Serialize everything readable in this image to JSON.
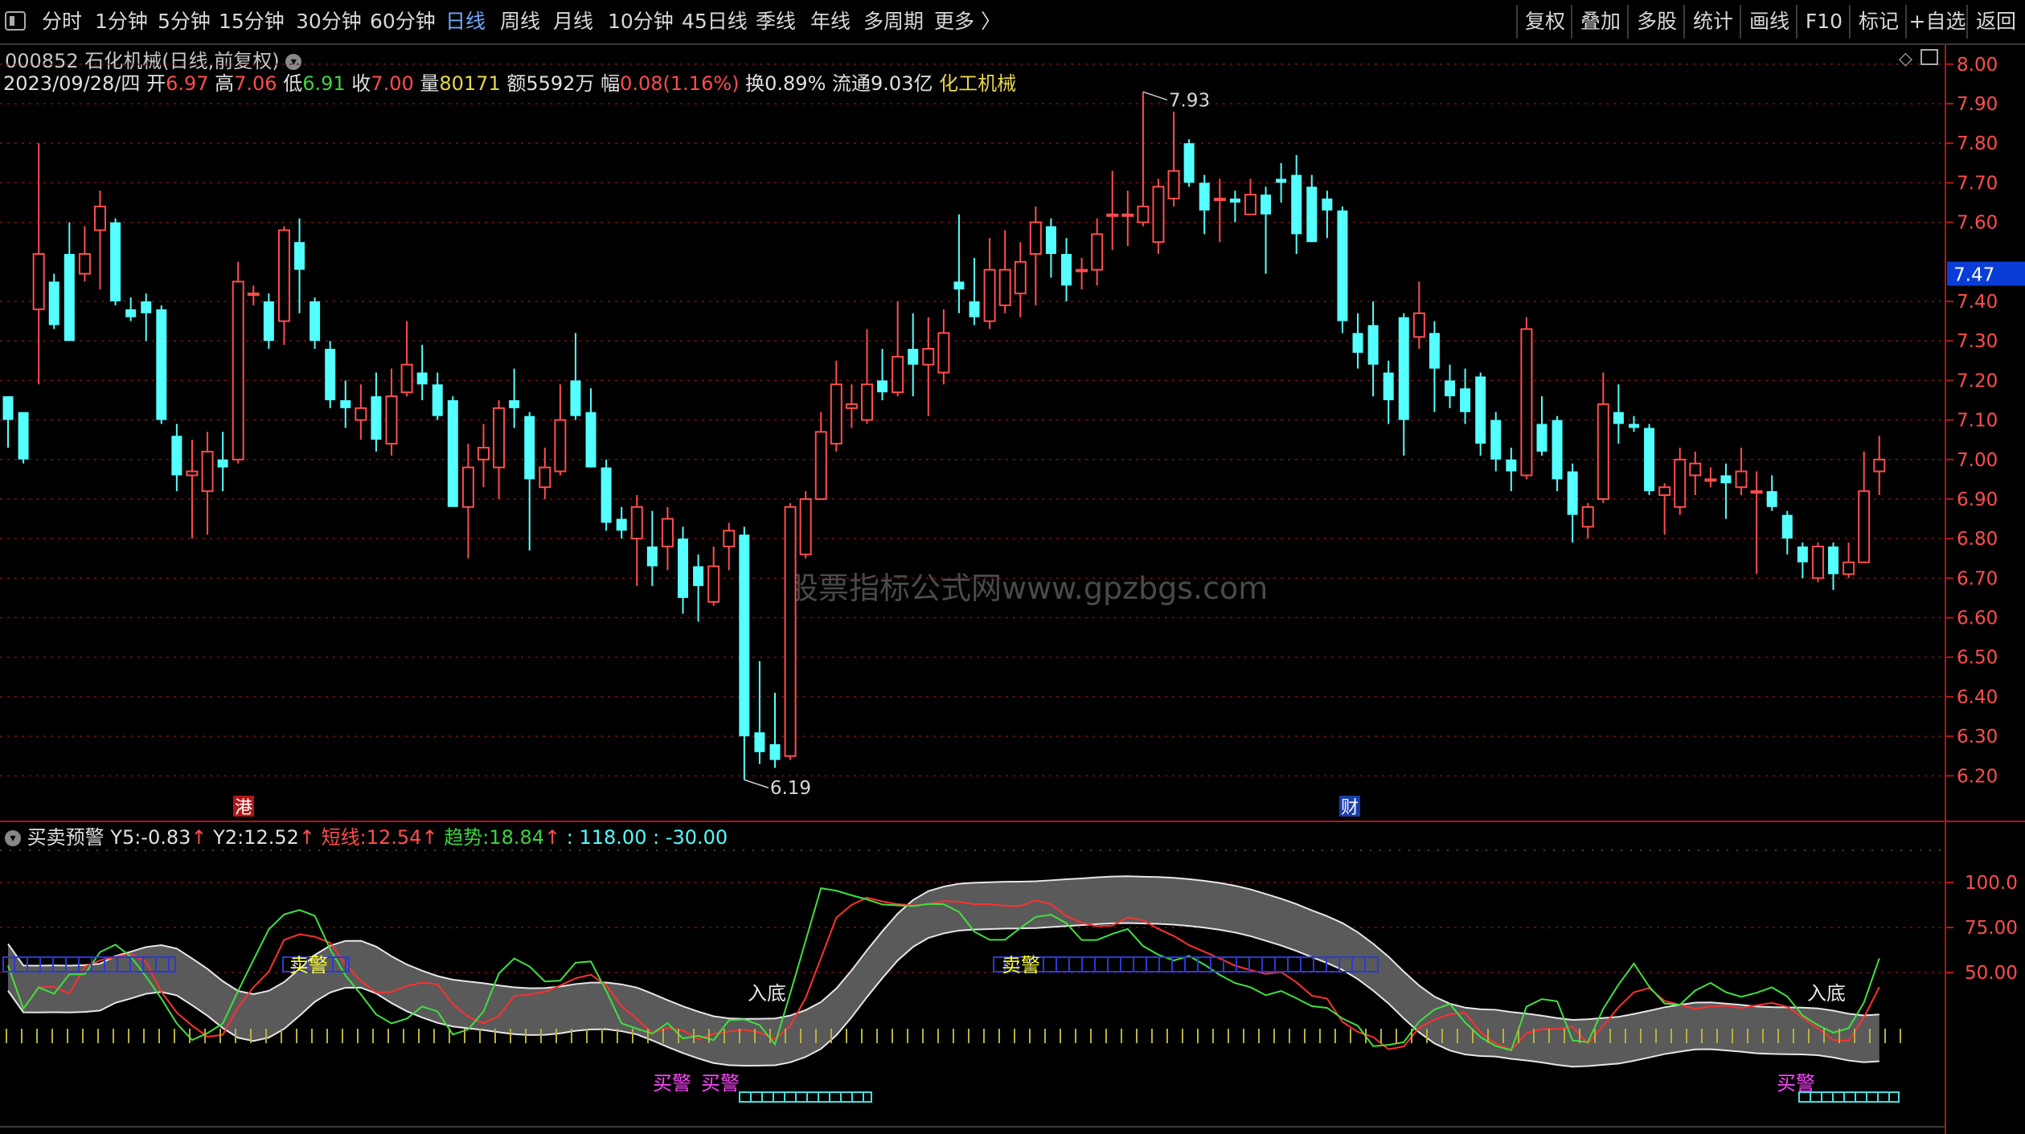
{
  "toolbar": {
    "periods": [
      "分时",
      "1分钟",
      "5分钟",
      "15分钟",
      "30分钟",
      "60分钟",
      "日线",
      "周线",
      "月线",
      "10分钟",
      "45日线",
      "季线",
      "年线",
      "多周期",
      "更多"
    ],
    "active_index": 6,
    "right_buttons": [
      "复权",
      "叠加",
      "多股",
      "统计",
      "画线",
      "F10",
      "标记",
      "+自选",
      "返回"
    ]
  },
  "stock": {
    "title": "000852 石化机械(日线,前复权)",
    "date": "2023/09/28/四",
    "open_label": "开",
    "open": "6.97",
    "high_label": "高",
    "high": "7.06",
    "low_label": "低",
    "low": "6.91",
    "close_label": "收",
    "close": "7.00",
    "volume_label": "量",
    "volume": "80171",
    "amount_label": "额",
    "amount": "5592万",
    "change_label": "幅",
    "change": "0.08(1.16%)",
    "turnover_label": "换",
    "turnover": "0.89%",
    "float_label": "流通",
    "float_cap": "9.03亿",
    "sector": "化工机械"
  },
  "watermark": "股票指标公式网www.gpzbgs.com",
  "price_axis": {
    "ticks": [
      "8.00",
      "7.90",
      "7.80",
      "7.70",
      "7.60",
      "7.40",
      "7.30",
      "7.20",
      "7.10",
      "7.00",
      "6.90",
      "6.80",
      "6.70",
      "6.60",
      "6.50",
      "6.40",
      "6.30",
      "6.20"
    ],
    "current": "7.47"
  },
  "markers": {
    "max": "7.93",
    "min": "6.19",
    "event_gang": "港",
    "event_cai": "财"
  },
  "indicator": {
    "name": "买卖预警",
    "y5_label": "Y5:",
    "y5": "-0.83",
    "y2_label": "Y2:",
    "y2": "12.52",
    "short_label": "短线:",
    "short": "12.54",
    "trend_label": "趋势:",
    "trend": "18.84",
    "c1": ": 118.00",
    "c2": ": -30.00",
    "axis": [
      "100.0",
      "75.00",
      "50.00"
    ],
    "labels": {
      "sell": "卖警",
      "buy": "买警",
      "bottom": "入底"
    }
  },
  "colors": {
    "up": "#ff4d4d",
    "down": "#54ffff",
    "grid": "#7a1010",
    "bg": "#000000"
  },
  "chart_data": {
    "type": "candlestick",
    "ylim": [
      6.16,
      8.02
    ],
    "candles": [
      [
        7.16,
        7.1,
        7.16,
        7.03
      ],
      [
        7.12,
        7.0,
        7.11,
        6.99
      ],
      [
        7.38,
        7.52,
        7.8,
        7.19
      ],
      [
        7.45,
        7.34,
        7.47,
        7.33
      ],
      [
        7.52,
        7.3,
        7.6,
        7.3
      ],
      [
        7.47,
        7.52,
        7.59,
        7.45
      ],
      [
        7.58,
        7.64,
        7.68,
        7.43
      ],
      [
        7.6,
        7.4,
        7.61,
        7.39
      ],
      [
        7.38,
        7.36,
        7.41,
        7.35
      ],
      [
        7.4,
        7.37,
        7.42,
        7.3
      ],
      [
        7.38,
        7.1,
        7.39,
        7.09
      ],
      [
        7.06,
        6.96,
        7.09,
        6.92
      ],
      [
        6.96,
        6.97,
        7.05,
        6.8
      ],
      [
        6.92,
        7.02,
        7.07,
        6.81
      ],
      [
        7.0,
        6.98,
        7.07,
        6.92
      ],
      [
        7.0,
        7.45,
        7.5,
        6.99
      ],
      [
        7.42,
        7.42,
        7.44,
        7.39
      ],
      [
        7.4,
        7.3,
        7.42,
        7.28
      ],
      [
        7.35,
        7.58,
        7.59,
        7.29
      ],
      [
        7.55,
        7.48,
        7.61,
        7.37
      ],
      [
        7.4,
        7.3,
        7.41,
        7.28
      ],
      [
        7.28,
        7.15,
        7.3,
        7.13
      ],
      [
        7.15,
        7.13,
        7.2,
        7.08
      ],
      [
        7.1,
        7.13,
        7.19,
        7.05
      ],
      [
        7.16,
        7.05,
        7.22,
        7.02
      ],
      [
        7.04,
        7.16,
        7.23,
        7.01
      ],
      [
        7.17,
        7.24,
        7.35,
        7.16
      ],
      [
        7.22,
        7.19,
        7.29,
        7.15
      ],
      [
        7.19,
        7.11,
        7.22,
        7.1
      ],
      [
        7.15,
        6.88,
        7.16,
        6.88
      ],
      [
        6.88,
        6.98,
        7.04,
        6.75
      ],
      [
        7.0,
        7.03,
        7.09,
        6.93
      ],
      [
        6.98,
        7.13,
        7.15,
        6.9
      ],
      [
        7.15,
        7.13,
        7.23,
        7.08
      ],
      [
        7.11,
        6.95,
        7.12,
        6.77
      ],
      [
        6.93,
        6.98,
        7.03,
        6.9
      ],
      [
        6.97,
        7.1,
        7.19,
        6.96
      ],
      [
        7.2,
        7.11,
        7.32,
        7.1
      ],
      [
        7.12,
        6.98,
        7.18,
        6.98
      ],
      [
        6.98,
        6.84,
        7.0,
        6.82
      ],
      [
        6.85,
        6.82,
        6.88,
        6.8
      ],
      [
        6.8,
        6.88,
        6.91,
        6.68
      ],
      [
        6.78,
        6.73,
        6.87,
        6.68
      ],
      [
        6.78,
        6.85,
        6.88,
        6.72
      ],
      [
        6.8,
        6.65,
        6.83,
        6.61
      ],
      [
        6.73,
        6.68,
        6.76,
        6.59
      ],
      [
        6.64,
        6.73,
        6.78,
        6.63
      ],
      [
        6.78,
        6.82,
        6.84,
        6.72
      ],
      [
        6.81,
        6.3,
        6.83,
        6.19
      ],
      [
        6.31,
        6.26,
        6.49,
        6.23
      ],
      [
        6.28,
        6.24,
        6.41,
        6.22
      ],
      [
        6.25,
        6.88,
        6.89,
        6.24
      ],
      [
        6.76,
        6.9,
        6.92,
        6.75
      ],
      [
        6.9,
        7.07,
        7.12,
        6.9
      ],
      [
        7.04,
        7.19,
        7.25,
        7.02
      ],
      [
        7.13,
        7.14,
        7.19,
        7.08
      ],
      [
        7.1,
        7.19,
        7.33,
        7.09
      ],
      [
        7.2,
        7.17,
        7.28,
        7.15
      ],
      [
        7.17,
        7.26,
        7.4,
        7.16
      ],
      [
        7.28,
        7.24,
        7.37,
        7.16
      ],
      [
        7.24,
        7.28,
        7.36,
        7.11
      ],
      [
        7.22,
        7.32,
        7.38,
        7.19
      ],
      [
        7.45,
        7.43,
        7.62,
        7.37
      ],
      [
        7.4,
        7.36,
        7.51,
        7.34
      ],
      [
        7.35,
        7.48,
        7.56,
        7.33
      ],
      [
        7.39,
        7.48,
        7.58,
        7.37
      ],
      [
        7.42,
        7.5,
        7.55,
        7.36
      ],
      [
        7.52,
        7.6,
        7.64,
        7.39
      ],
      [
        7.59,
        7.52,
        7.61,
        7.46
      ],
      [
        7.52,
        7.44,
        7.56,
        7.4
      ],
      [
        7.48,
        7.48,
        7.51,
        7.43
      ],
      [
        7.48,
        7.57,
        7.61,
        7.44
      ],
      [
        7.62,
        7.62,
        7.73,
        7.53
      ],
      [
        7.62,
        7.62,
        7.68,
        7.54
      ],
      [
        7.6,
        7.64,
        7.93,
        7.59
      ],
      [
        7.55,
        7.69,
        7.71,
        7.52
      ],
      [
        7.66,
        7.73,
        7.88,
        7.64
      ],
      [
        7.8,
        7.7,
        7.81,
        7.69
      ],
      [
        7.7,
        7.63,
        7.72,
        7.57
      ],
      [
        7.66,
        7.66,
        7.71,
        7.55
      ],
      [
        7.66,
        7.65,
        7.68,
        7.6
      ],
      [
        7.62,
        7.67,
        7.71,
        7.63
      ],
      [
        7.67,
        7.62,
        7.69,
        7.47
      ],
      [
        7.71,
        7.7,
        7.75,
        7.65
      ],
      [
        7.72,
        7.57,
        7.77,
        7.52
      ],
      [
        7.69,
        7.55,
        7.72,
        7.55
      ],
      [
        7.66,
        7.63,
        7.68,
        7.56
      ],
      [
        7.63,
        7.35,
        7.64,
        7.32
      ],
      [
        7.32,
        7.27,
        7.37,
        7.23
      ],
      [
        7.34,
        7.24,
        7.4,
        7.16
      ],
      [
        7.22,
        7.15,
        7.25,
        7.09
      ],
      [
        7.36,
        7.1,
        7.37,
        7.01
      ],
      [
        7.31,
        7.37,
        7.45,
        7.28
      ],
      [
        7.32,
        7.23,
        7.35,
        7.12
      ],
      [
        7.2,
        7.16,
        7.24,
        7.13
      ],
      [
        7.18,
        7.12,
        7.23,
        7.09
      ],
      [
        7.21,
        7.04,
        7.22,
        7.01
      ],
      [
        7.1,
        7.0,
        7.12,
        6.97
      ],
      [
        7.0,
        6.97,
        7.03,
        6.92
      ],
      [
        6.96,
        7.33,
        7.36,
        6.95
      ],
      [
        7.09,
        7.02,
        7.16,
        7.01
      ],
      [
        7.1,
        6.95,
        7.11,
        6.92
      ],
      [
        6.97,
        6.86,
        6.99,
        6.79
      ],
      [
        6.83,
        6.88,
        6.89,
        6.8
      ],
      [
        6.9,
        7.14,
        7.22,
        6.89
      ],
      [
        7.12,
        7.09,
        7.19,
        7.04
      ],
      [
        7.09,
        7.08,
        7.11,
        7.07
      ],
      [
        7.08,
        6.92,
        7.09,
        6.91
      ],
      [
        6.91,
        6.93,
        6.94,
        6.81
      ],
      [
        6.88,
        7.0,
        7.03,
        6.86
      ],
      [
        6.96,
        6.99,
        7.02,
        6.91
      ],
      [
        6.95,
        6.95,
        6.98,
        6.93
      ],
      [
        6.96,
        6.94,
        6.99,
        6.85
      ],
      [
        6.93,
        6.97,
        7.03,
        6.91
      ],
      [
        6.92,
        6.92,
        6.97,
        6.71
      ],
      [
        6.92,
        6.88,
        6.96,
        6.87
      ],
      [
        6.86,
        6.8,
        6.87,
        6.76
      ],
      [
        6.78,
        6.74,
        6.79,
        6.7
      ],
      [
        6.7,
        6.78,
        6.79,
        6.69
      ],
      [
        6.78,
        6.71,
        6.79,
        6.67
      ],
      [
        6.71,
        6.74,
        6.79,
        6.7
      ],
      [
        6.74,
        6.92,
        7.02,
        6.74
      ],
      [
        6.97,
        7.0,
        7.06,
        6.91
      ]
    ]
  }
}
